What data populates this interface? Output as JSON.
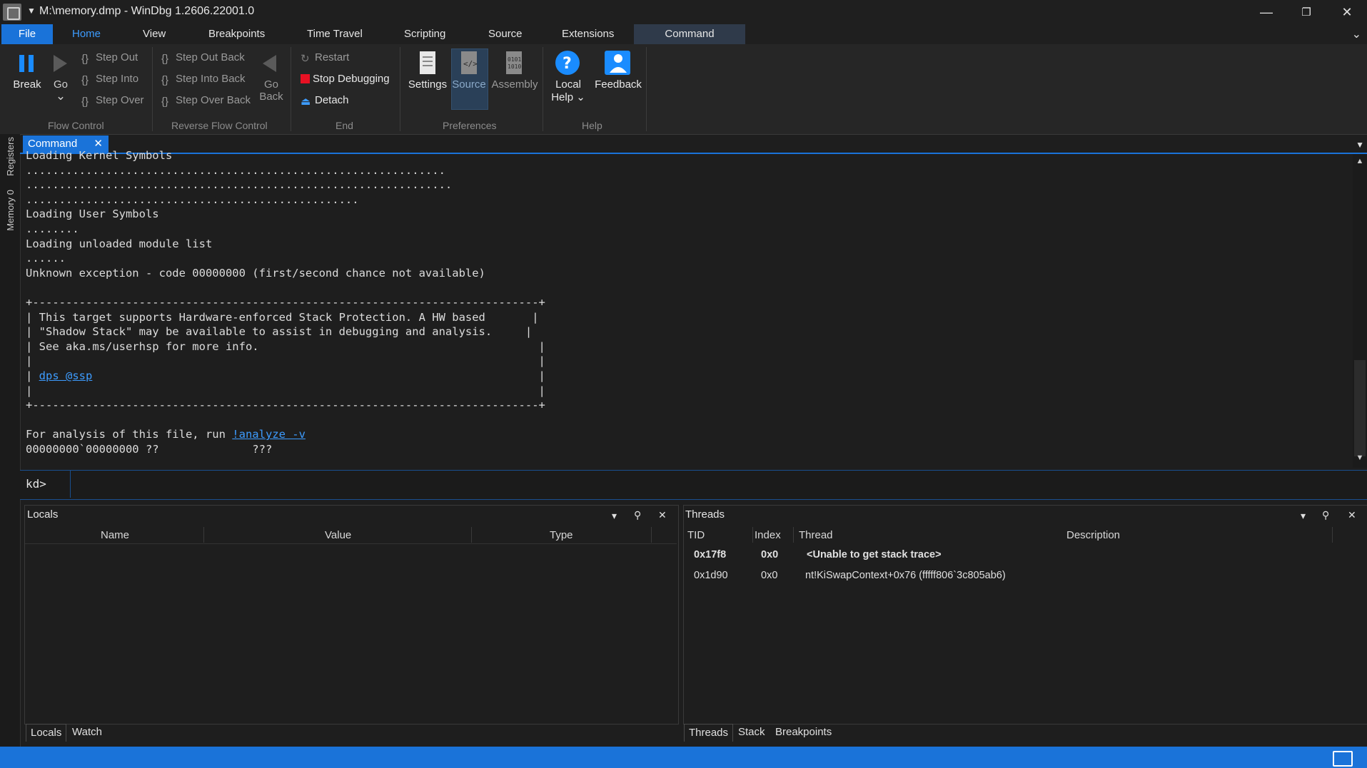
{
  "window": {
    "title": "M:\\memory.dmp - WinDbg 1.2606.22001.0",
    "caret": "▼",
    "minimize": "—",
    "restore": "❐",
    "close": "✕"
  },
  "ribbon_tabs": [
    "File",
    "Home",
    "View",
    "Breakpoints",
    "Time Travel",
    "Scripting",
    "Source",
    "Extensions",
    "Command"
  ],
  "ribbon": {
    "flow_control": {
      "label": "Flow Control",
      "break": "Break",
      "go": "Go",
      "go_caret": "⌄",
      "step_out": "Step Out",
      "step_into": "Step Into",
      "step_over": "Step Over"
    },
    "reverse_flow_control": {
      "label": "Reverse Flow Control",
      "step_out_back": "Step Out Back",
      "step_into_back": "Step Into Back",
      "step_over_back": "Step Over Back",
      "go_back_1": "Go",
      "go_back_2": "Back"
    },
    "end": {
      "label": "End",
      "restart": "Restart",
      "stop_debugging": "Stop Debugging",
      "detach": "Detach"
    },
    "preferences": {
      "label": "Preferences",
      "settings": "Settings",
      "source": "Source",
      "assembly": "Assembly"
    },
    "help": {
      "label": "Help",
      "local_help_1": "Local",
      "local_help_2": "Help ⌄",
      "feedback": "Feedback"
    }
  },
  "side_rail": [
    "Registers",
    "Memory 0"
  ],
  "command_window": {
    "tab": "Command",
    "tab_close": "✕",
    "lines": [
      "Loading Kernel Symbols",
      "...............................................................",
      "................................................................",
      "..................................................",
      "Loading User Symbols",
      "........",
      "Loading unloaded module list",
      "......",
      "Unknown exception - code 00000000 (first/second chance not available)",
      "",
      "+----------------------------------------------------------------------------+",
      "| This target supports Hardware-enforced Stack Protection. A HW based       |",
      "| \"Shadow Stack\" may be available to assist in debugging and analysis.     |",
      "| See aka.ms/userhsp for more info.                                          |",
      "|                                                                            |",
      "|                                                                            |",
      "|                                                                            |",
      "+----------------------------------------------------------------------------+",
      "",
      "",
      "00000000`00000000 ??              ???"
    ],
    "link_line_prefix": "| ",
    "link_line_link": "dps @ssp",
    "link_line_suffix": "                                                                   |",
    "analysis_prefix": "For analysis of this file, run ",
    "analysis_link": "!analyze -v",
    "prompt": "kd>",
    "input_value": ""
  },
  "locals": {
    "title": "Locals",
    "columns": [
      "Name",
      "Value",
      "Type"
    ],
    "tabs": [
      "Locals",
      "Watch"
    ]
  },
  "threads": {
    "title": "Threads",
    "columns": [
      "TID",
      "Index",
      "Thread",
      "Description"
    ],
    "rows": [
      {
        "tid": "0x17f8",
        "index": "0x0",
        "thread": "<Unable to get stack trace>",
        "bold": true
      },
      {
        "tid": "0x1d90",
        "index": "0x0",
        "thread": "nt!KiSwapContext+0x76 (fffff806`3c805ab6)",
        "bold": false
      }
    ],
    "tabs": [
      "Threads",
      "Stack",
      "Breakpoints"
    ]
  },
  "pane_controls": {
    "dropdown": "▾",
    "pin": "⚲",
    "close": "✕"
  },
  "colors": {
    "accent": "#1a73d9",
    "link": "#3d9cff",
    "stop": "#e81123",
    "background": "#1e1e1e"
  }
}
